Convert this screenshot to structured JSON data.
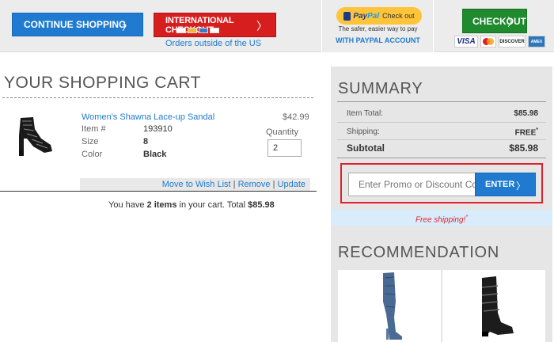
{
  "topbar": {
    "continue_label": "CONTINUE SHOPPING",
    "international_label": "INTERNATIONAL CHECKOUT",
    "international_note": "Orders outside of the US",
    "paypal_button": "Check out",
    "paypal_brand_a": "Pay",
    "paypal_brand_b": "Pal",
    "paypal_tagline": "The safer, easier way to pay",
    "paypal_with": "WITH PAYPAL ACCOUNT",
    "checkout_label": "CHECKOUT",
    "card_visa": "VISA",
    "card_discover": "DISCOVER",
    "card_amex": "AMEX"
  },
  "cart": {
    "title": "YOUR SHOPPING CART",
    "item": {
      "name": "Women's Shawna Lace-up Sandal",
      "price": "$42.99",
      "item_label": "Item #",
      "item_no": "193910",
      "size_label": "Size",
      "size": "8",
      "color_label": "Color",
      "color": "Black",
      "qty_label": "Quantity",
      "qty": "2"
    },
    "actions": {
      "wishlist": "Move to Wish List",
      "remove": "Remove",
      "update": "Update",
      "sep": "|"
    },
    "summary_line": {
      "pre": "You have ",
      "count": "2 items",
      "mid": " in your cart. Total ",
      "total": "$85.98"
    }
  },
  "summary": {
    "title": "SUMMARY",
    "item_total_label": "Item Total:",
    "item_total": "$85.98",
    "shipping_label": "Shipping:",
    "shipping": "FREE",
    "shipping_mark": "*",
    "subtotal_label": "Subtotal",
    "subtotal": "$85.98",
    "promo_placeholder": "Enter Promo or Discount Code",
    "promo_button": "ENTER",
    "free_shipping": "Free shipping!",
    "free_shipping_mark": "*"
  },
  "recommendation": {
    "title": "RECOMMENDATION"
  },
  "icons": {
    "chevron": "〉"
  },
  "colors": {
    "primary_blue": "#1f7ad0",
    "intl_red": "#d71e1e",
    "checkout_green": "#1f8a2e",
    "paypal_yellow": "#ffc439",
    "promo_highlight": "#e0202a"
  }
}
